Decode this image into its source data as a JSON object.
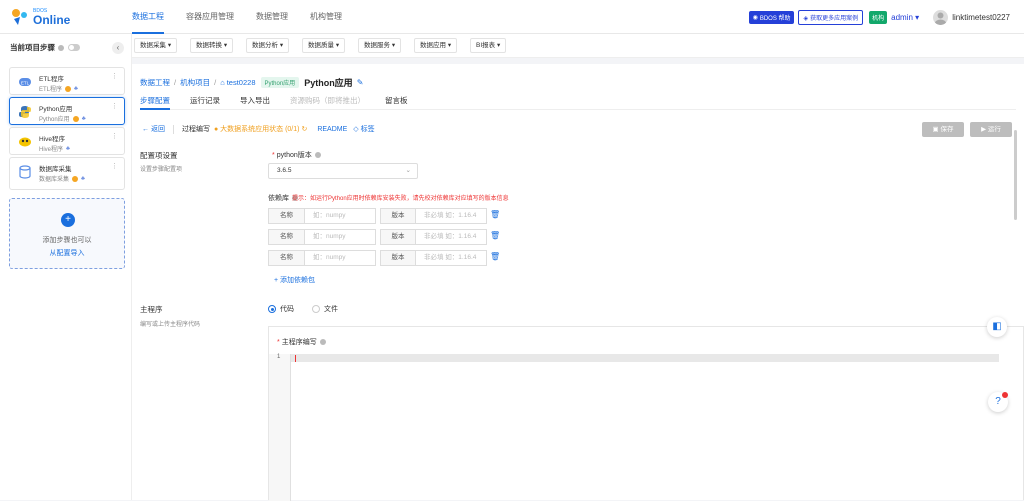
{
  "header": {
    "logo_small": "BDOS",
    "logo_big": "Online",
    "nav": [
      "数据工程",
      "容器应用管理",
      "数据管理",
      "机构管理"
    ],
    "help_label": "BDOS 帮助",
    "cases_label": "获取更多应用案例",
    "org_tag": "机构",
    "org_name": "admin",
    "user": "linktimetest0227"
  },
  "sidebar": {
    "title": "当前项目步骤",
    "steps": [
      {
        "title": "ETL程序",
        "sub": "ETL程序"
      },
      {
        "title": "Python应用",
        "sub": "Python应用"
      },
      {
        "title": "Hive程序",
        "sub": "Hive程序"
      },
      {
        "title": "数据库采集",
        "sub": "数据库采集"
      }
    ],
    "add_text": "添加步骤也可以",
    "add_link": "从配置导入"
  },
  "toolbar": [
    "数据采集",
    "数据转换",
    "数据分析",
    "数据质量",
    "数据服务",
    "数据应用",
    "BI报表"
  ],
  "breadcrumb": {
    "p1": "数据工程",
    "p2": "机构项目",
    "p3": "test0228",
    "tag": "Python应用",
    "title": "Python应用"
  },
  "tabs": [
    "步骤配置",
    "运行记录",
    "导入导出",
    "资源购码（即将推出）",
    "留言板"
  ],
  "subbar": {
    "back": "返回",
    "proc": "过程编写",
    "status": "大数据系统应用状态 (0/1)",
    "readme": "README",
    "tag": "标签",
    "save": "保存",
    "run": "运行"
  },
  "config": {
    "title": "配置项设置",
    "desc": "设置步骤配置项",
    "py_label": "python版本",
    "py_value": "3.6.5",
    "dep_label": "依赖库",
    "dep_tip": "提示：如运行Python应用时依赖库安装失败，请先校对依赖库对应填写的版本信息",
    "col_name": "名称",
    "name_ph": "如：numpy",
    "col_ver": "版本",
    "ver_ph": "非必填 如：1.16.4",
    "add_dep": "+ 添加依赖包"
  },
  "main_prog": {
    "title": "主程序",
    "desc": "编写或上传主程序代码",
    "opt_code": "代码",
    "opt_file": "文件",
    "editor_label": "主程序编写",
    "line1": "1"
  },
  "colors": {
    "accent": "#1a6fde",
    "warning": "#f0a020",
    "danger": "#e33333",
    "success": "#13a86b"
  }
}
